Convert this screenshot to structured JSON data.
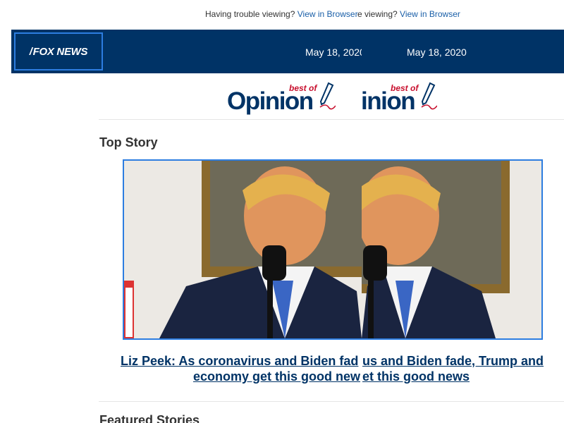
{
  "preheader": {
    "left": {
      "trouble_text": "Having trouble viewing? ",
      "link_text": "View in Browser"
    },
    "right": {
      "trouble_text": "e viewing? ",
      "link_text": "View in Browser"
    }
  },
  "header": {
    "logo_text": "FOX NEWS",
    "date_left": "May 18, 2020",
    "date_right": "May 18, 2020",
    "bg_color": "#003366"
  },
  "opinion_banner": {
    "left": {
      "word": "Opinion",
      "best_of": "best of"
    },
    "right": {
      "word": "inion",
      "best_of": "best of"
    }
  },
  "top_story": {
    "section_title": "Top Story",
    "headline_line1_left": "Liz Peek: As coronavirus and Biden fad",
    "headline_line1_right": "us and Biden fade, Trump and",
    "headline_line2_left": "economy get this good new",
    "headline_line2_right": "et this good news",
    "image_icon": "speaker-at-podium-photo"
  },
  "featured": {
    "section_title": "Featured Stories"
  },
  "colors": {
    "brand_navy": "#003366",
    "link_blue": "#1a5fa8",
    "accent_red": "#c8102e",
    "frame_blue": "#2d7de0"
  }
}
